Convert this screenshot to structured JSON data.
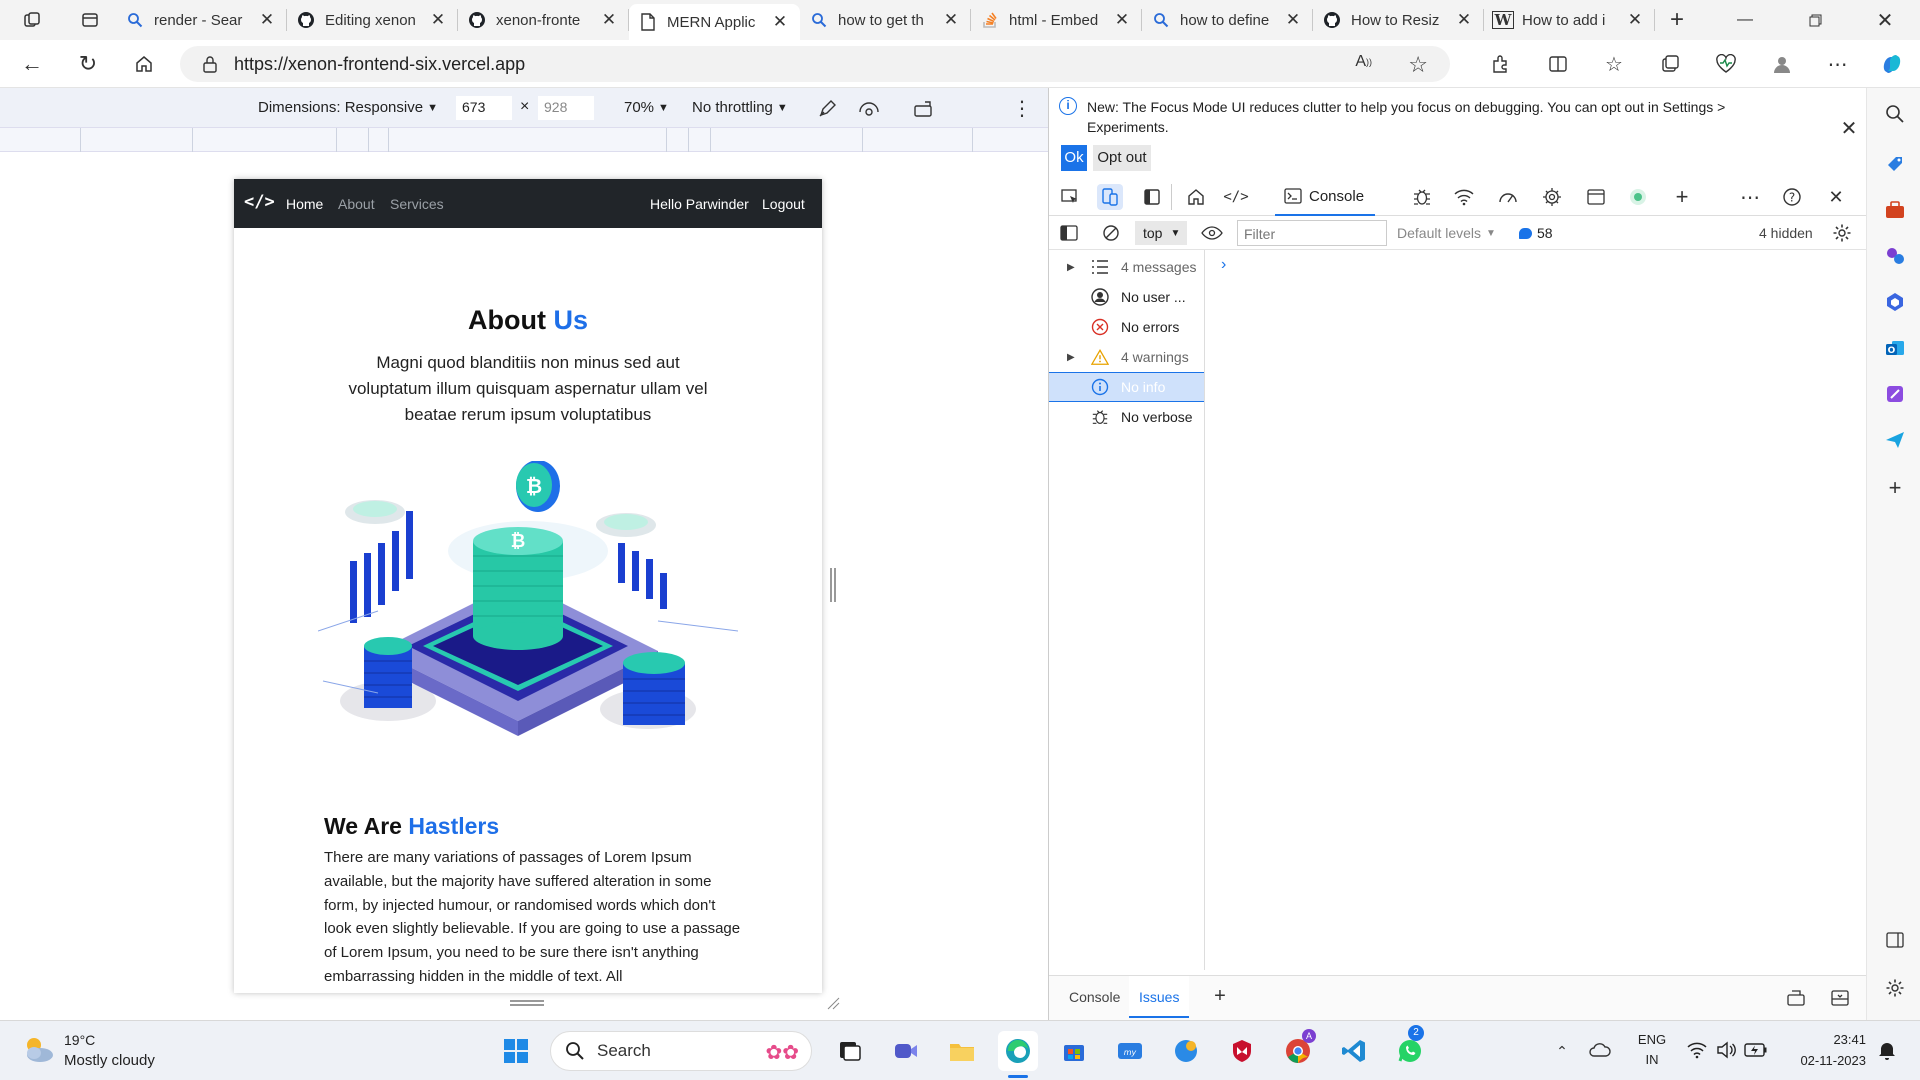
{
  "browser": {
    "tabs": [
      {
        "title": "render - Sear",
        "icon": "search-icon"
      },
      {
        "title": "Editing xenon",
        "icon": "github-icon"
      },
      {
        "title": "xenon-fronte",
        "icon": "github-icon"
      },
      {
        "title": "MERN Applic",
        "icon": "page-icon",
        "active": true
      },
      {
        "title": "how to get th",
        "icon": "search-icon"
      },
      {
        "title": "html - Embed",
        "icon": "stackoverflow-icon"
      },
      {
        "title": "how to define",
        "icon": "search-icon"
      },
      {
        "title": "How to Resiz",
        "icon": "github-icon"
      },
      {
        "title": "How to add i",
        "icon": "wikipedia-icon"
      }
    ],
    "url": "https://xenon-frontend-six.vercel.app"
  },
  "device_toolbar": {
    "dimensions_label": "Dimensions: Responsive",
    "width": "673",
    "height": "928",
    "zoom": "70%",
    "throttling": "No throttling"
  },
  "site": {
    "nav": {
      "links": [
        "Home",
        "About",
        "Services"
      ],
      "greeting": "Hello Parwinder",
      "logout": "Logout"
    },
    "about": {
      "title_main": "About",
      "title_accent": "Us",
      "text": "Magni quod blanditiis non minus sed aut voluptatum illum quisquam aspernatur ullam vel beatae rerum ipsum voluptatibus"
    },
    "we_are": {
      "title_main": "We Are",
      "title_accent": "Hastlers",
      "text": "There are many variations of passages of Lorem Ipsum available, but the majority have suffered alteration in some form, by injected humour, or randomised words which don't look even slightly believable. If you are going to use a passage of Lorem Ipsum, you need to be sure there isn't anything embarrassing hidden in the middle of text. All"
    }
  },
  "devtools": {
    "notice": "New: The Focus Mode UI reduces clutter to help you focus on debugging. You can opt out in Settings > Experiments.",
    "ok_label": "Ok",
    "optout_label": "Opt out",
    "active_tab": "Console",
    "context": "top",
    "filter_placeholder": "Filter",
    "levels": "Default levels",
    "message_count": "58",
    "hidden_count": "4 hidden",
    "sidebar": [
      {
        "label": "4 messages",
        "icon": "list-icon",
        "expandable": true,
        "muted": true
      },
      {
        "label": "No user ...",
        "icon": "user-icon",
        "expandable": false
      },
      {
        "label": "No errors",
        "icon": "error-icon",
        "expandable": false
      },
      {
        "label": "4 warnings",
        "icon": "warning-icon",
        "expandable": true,
        "muted": true
      },
      {
        "label": "No info",
        "icon": "info-icon",
        "expandable": false,
        "selected": true
      },
      {
        "label": "No verbose",
        "icon": "bug-icon",
        "expandable": false
      }
    ],
    "drawer_tabs": [
      "Console",
      "Issues"
    ],
    "drawer_active": "Issues"
  },
  "taskbar": {
    "weather_temp": "19°C",
    "weather_desc": "Mostly cloudy",
    "search_label": "Search",
    "lang_top": "ENG",
    "lang_bottom": "IN",
    "time": "23:41",
    "date": "02-11-2023",
    "whatsapp_badge": "2"
  },
  "colors": {
    "accent": "#1e6fe8",
    "navbar": "#212529",
    "devtools_blue": "#1a73e8"
  }
}
